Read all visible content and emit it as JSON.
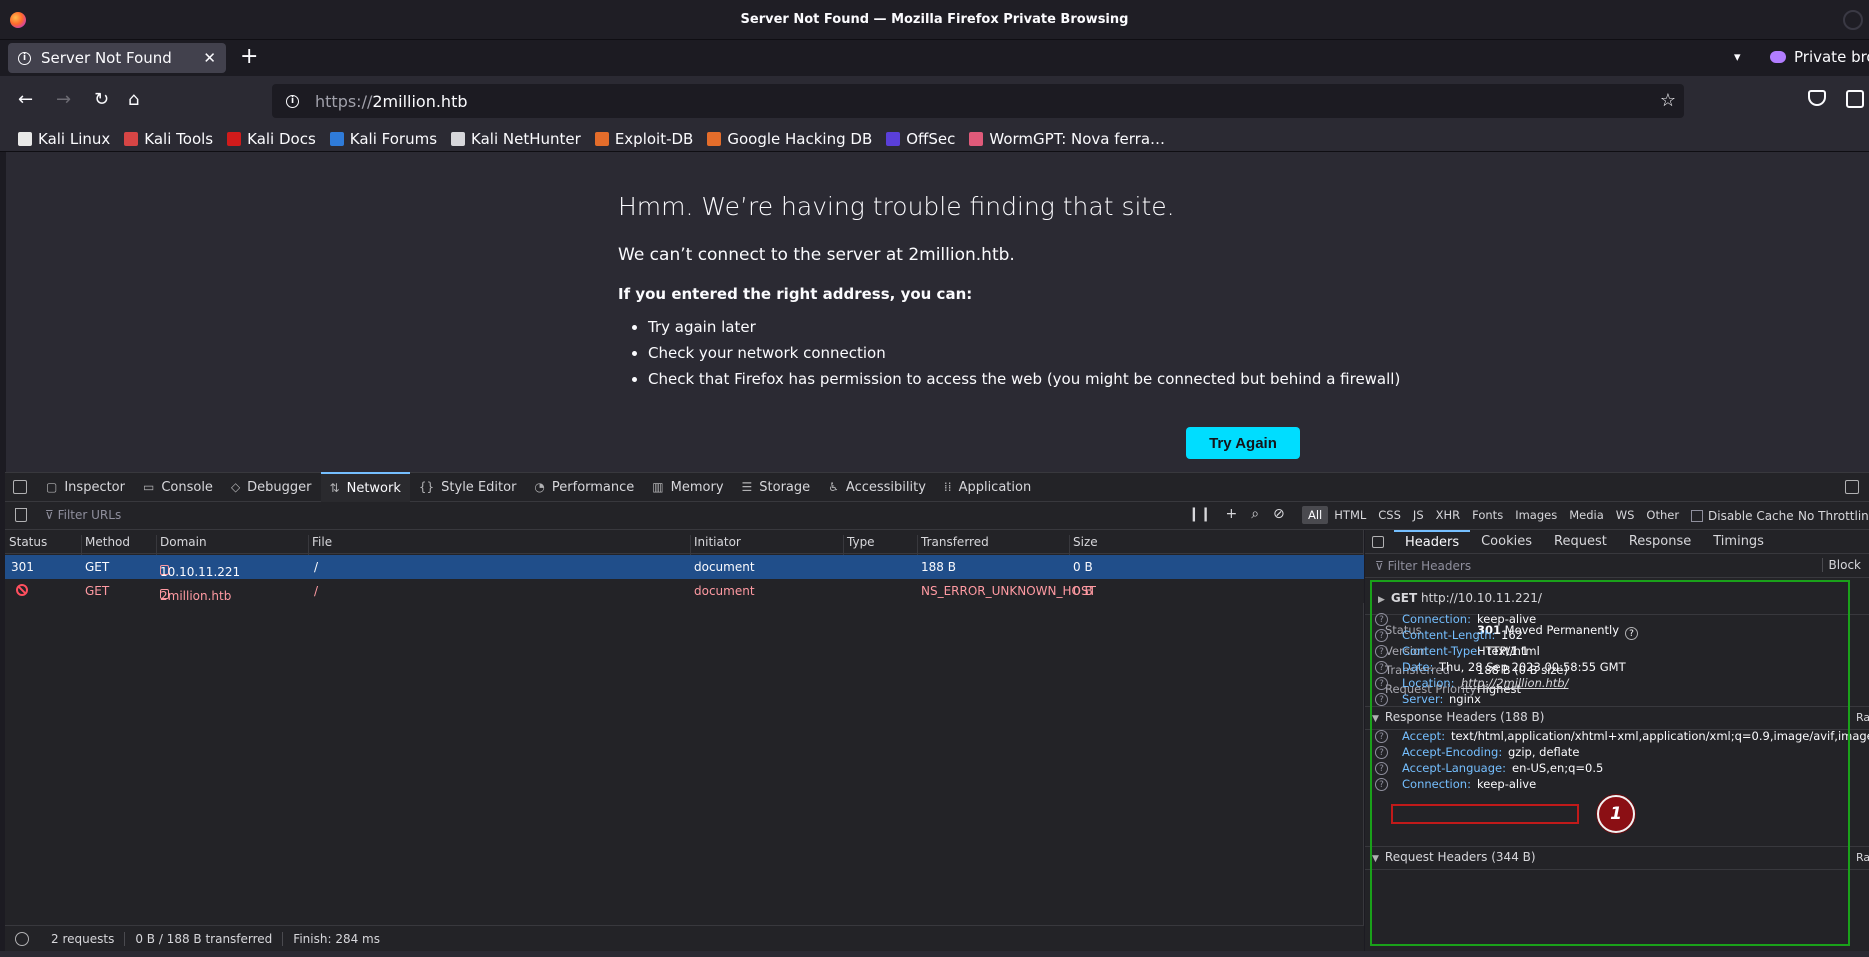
{
  "window": {
    "title": "Server Not Found — Mozilla Firefox Private Browsing"
  },
  "tabs": [
    {
      "label": "Server Not Found"
    }
  ],
  "private_label": "Private brow",
  "url": {
    "protocol": "https://",
    "host": "2million.htb"
  },
  "bookmarks": [
    {
      "label": "Kali Linux",
      "color": "#e8e8e8"
    },
    {
      "label": "Kali Tools",
      "color": "#d64545"
    },
    {
      "label": "Kali Docs",
      "color": "#d11b1b"
    },
    {
      "label": "Kali Forums",
      "color": "#2f7bd9"
    },
    {
      "label": "Kali NetHunter",
      "color": "#d7d7db"
    },
    {
      "label": "Exploit-DB",
      "color": "#e46d2b"
    },
    {
      "label": "Google Hacking DB",
      "color": "#e46d2b"
    },
    {
      "label": "OffSec",
      "color": "#5a3fd9"
    },
    {
      "label": "WormGPT: Nova ferra…",
      "color": "#e05a7a"
    }
  ],
  "error_page": {
    "title": "Hmm. We’re having trouble finding that site.",
    "subtitle": "We can’t connect to the server at 2million.htb.",
    "bold": "If you entered the right address, you can:",
    "items": [
      "Try again later",
      "Check your network connection",
      "Check that Firefox has permission to access the web (you might be connected but behind a firewall)"
    ],
    "button": "Try Again"
  },
  "devtools": {
    "tabs": [
      {
        "label": "Inspector",
        "glyph": "▢"
      },
      {
        "label": "Console",
        "glyph": "▭"
      },
      {
        "label": "Debugger",
        "glyph": "◇"
      },
      {
        "label": "Network",
        "glyph": "⇅"
      },
      {
        "label": "Style Editor",
        "glyph": "{}"
      },
      {
        "label": "Performance",
        "glyph": "◔"
      },
      {
        "label": "Memory",
        "glyph": "▥"
      },
      {
        "label": "Storage",
        "glyph": "☰"
      },
      {
        "label": "Accessibility",
        "glyph": "♿"
      },
      {
        "label": "Application",
        "glyph": "⁞⁞"
      }
    ],
    "active_tab": "Network"
  },
  "net_toolbar": {
    "filter_placeholder": "Filter URLs",
    "filters": [
      "All",
      "HTML",
      "CSS",
      "JS",
      "XHR",
      "Fonts",
      "Images",
      "Media",
      "WS",
      "Other"
    ],
    "disable_cache": "Disable Cache",
    "throttling": "No Throttling"
  },
  "table": {
    "columns": [
      "Status",
      "Method",
      "Domain",
      "File",
      "Initiator",
      "Type",
      "Transferred",
      "Size"
    ],
    "rows": [
      {
        "status": "301",
        "method": "GET",
        "domain": "10.10.11.221",
        "file": "/",
        "initiator": "document",
        "type": "",
        "transferred": "188 B",
        "size": "0 B"
      },
      {
        "status": "",
        "method": "GET",
        "domain": "2million.htb",
        "file": "/",
        "initiator": "document",
        "type": "",
        "transferred": "NS_ERROR_UNKNOWN_HOST",
        "size": "0 B"
      }
    ]
  },
  "statusbar": {
    "requests": "2 requests",
    "transferred": "0 B / 188 B transferred",
    "finish": "Finish: 284 ms"
  },
  "side_panel": {
    "tabs": [
      "Headers",
      "Cookies",
      "Request",
      "Response",
      "Timings"
    ],
    "filter_placeholder": "Filter Headers",
    "block": "Block",
    "request_line": {
      "method": "GET",
      "url": "http://10.10.11.221/"
    },
    "summary": [
      {
        "label": "Status",
        "code": "301",
        "value": "Moved Permanently"
      },
      {
        "label": "Version",
        "value": "HTTP/1.1"
      },
      {
        "label": "Transferred",
        "value": "188 B (0 B size)"
      },
      {
        "label": "Request Priority",
        "value": "Highest"
      }
    ],
    "response_headers_title": "Response Headers (188 B)",
    "response_headers": [
      {
        "name": "Connection:",
        "value": "keep-alive"
      },
      {
        "name": "Content-Length:",
        "value": "162"
      },
      {
        "name": "Content-Type:",
        "value": "text/html"
      },
      {
        "name": "Date:",
        "value": "Thu, 28 Sep 2023 00:58:55 GMT"
      },
      {
        "name": "Location:",
        "value": "http://2million.htb/"
      },
      {
        "name": "Server:",
        "value": "nginx"
      }
    ],
    "request_headers_title": "Request Headers (344 B)",
    "request_headers": [
      {
        "name": "Accept:",
        "value": "text/html,application/xhtml+xml,application/xml;q=0.9,image/avif,image/webp,*/*;q=0"
      },
      {
        "name": "Accept-Encoding:",
        "value": "gzip, deflate"
      },
      {
        "name": "Accept-Language:",
        "value": "en-US,en;q=0.5"
      },
      {
        "name": "Connection:",
        "value": "keep-alive"
      }
    ],
    "raw_label": "Ra",
    "annotation_badge": "1"
  }
}
